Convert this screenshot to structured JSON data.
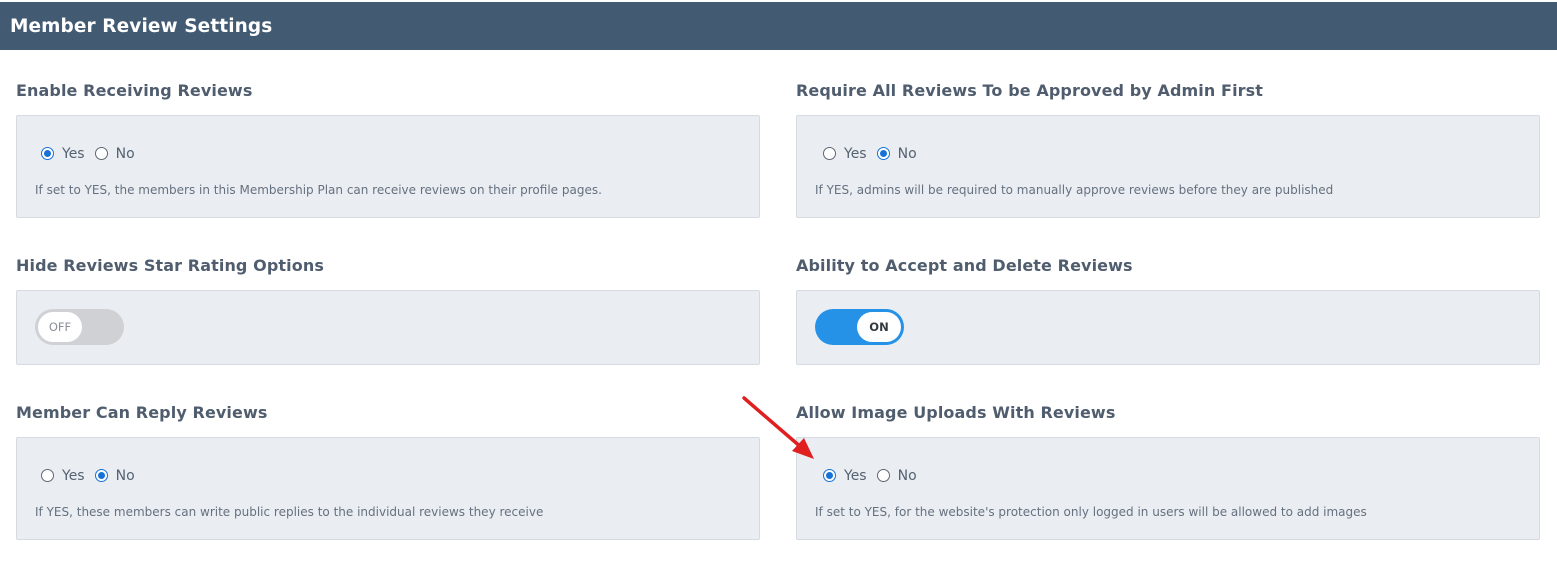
{
  "header": {
    "title": "Member Review Settings"
  },
  "sections": {
    "enable_receiving": {
      "label": "Enable Receiving Reviews",
      "options": [
        "Yes",
        "No"
      ],
      "selected": "Yes",
      "help": "If set to YES, the members in this Membership Plan can receive reviews on their profile pages."
    },
    "require_approval": {
      "label": "Require All Reviews To be Approved by Admin First",
      "options": [
        "Yes",
        "No"
      ],
      "selected": "No",
      "help": "If YES, admins will be required to manually approve reviews before they are published"
    },
    "hide_star_rating": {
      "label": "Hide Reviews Star Rating Options",
      "toggle_text": "OFF",
      "state": "off"
    },
    "accept_delete": {
      "label": "Ability to Accept and Delete Reviews",
      "toggle_text": "ON",
      "state": "on"
    },
    "member_reply": {
      "label": "Member Can Reply Reviews",
      "options": [
        "Yes",
        "No"
      ],
      "selected": "No",
      "help": "If YES, these members can write public replies to the individual reviews they receive"
    },
    "image_uploads": {
      "label": "Allow Image Uploads With Reviews",
      "options": [
        "Yes",
        "No"
      ],
      "selected": "Yes",
      "help": "If set to YES, for the website's protection only logged in users will be allowed to add images"
    }
  },
  "colors": {
    "header_bg": "#435a73",
    "radio_accent": "#1672d6",
    "toggle_on": "#2592e8",
    "toggle_off": "#cfd1d4",
    "annotation_arrow": "#e02020"
  }
}
